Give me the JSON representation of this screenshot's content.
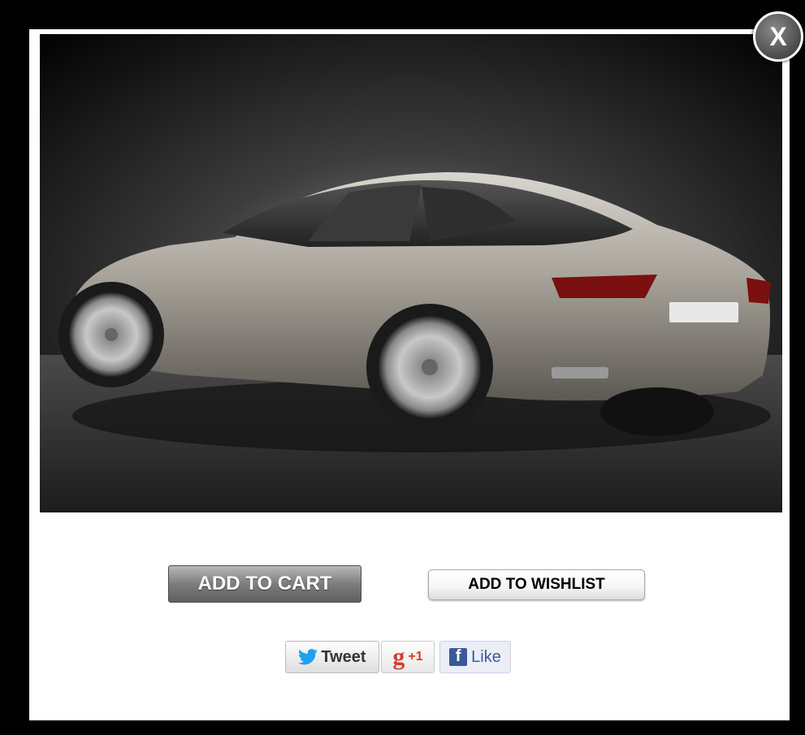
{
  "modal": {
    "close_label": "X",
    "buttons": {
      "add_to_cart": "ADD TO CART",
      "add_to_wishlist": "ADD TO WISHLIST"
    },
    "social": {
      "tweet": "Tweet",
      "gplus_letter": "g",
      "gplus_count": "+1",
      "fb_letter": "f",
      "fb_like": "Like"
    }
  },
  "colors": {
    "accent_twitter": "#1da1f2",
    "accent_gplus": "#d23f31",
    "accent_facebook": "#3b5998"
  }
}
